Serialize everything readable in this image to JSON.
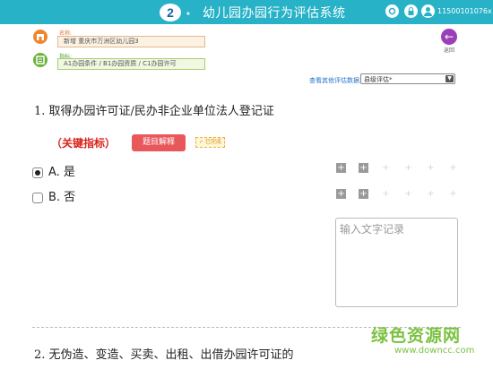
{
  "header": {
    "title": "幼儿园办园行为评估系统",
    "user_id": "11500101076x",
    "colors": {
      "bar": "#27b2c7"
    }
  },
  "info": {
    "name_label": "名称:",
    "name_value": "新增 重庆市万洲区幼儿园3",
    "indicator_label": "指标:",
    "indicator_value": "A1办园条件 / B1办园资质 / C1办园许可"
  },
  "back": {
    "label": "返回"
  },
  "eval": {
    "link": "查看其他评估数据:",
    "selected": "县级评估*"
  },
  "question1": {
    "text": "1. 取得办园许可证/民办非企业单位法人登记证",
    "key_indicator": "（关键指标）",
    "explain_button": "题目解释",
    "done_badge": "已完成"
  },
  "options": [
    {
      "label": "A. 是",
      "selected": true
    },
    {
      "label": "B. 否",
      "selected": false
    }
  ],
  "record": {
    "placeholder": "输入文字记录"
  },
  "question2": {
    "text": "2. 无伪造、变造、买卖、出租、出借办园许可证的"
  },
  "watermark": {
    "main": "绿色资源网",
    "sub": "www.downcc.com"
  }
}
